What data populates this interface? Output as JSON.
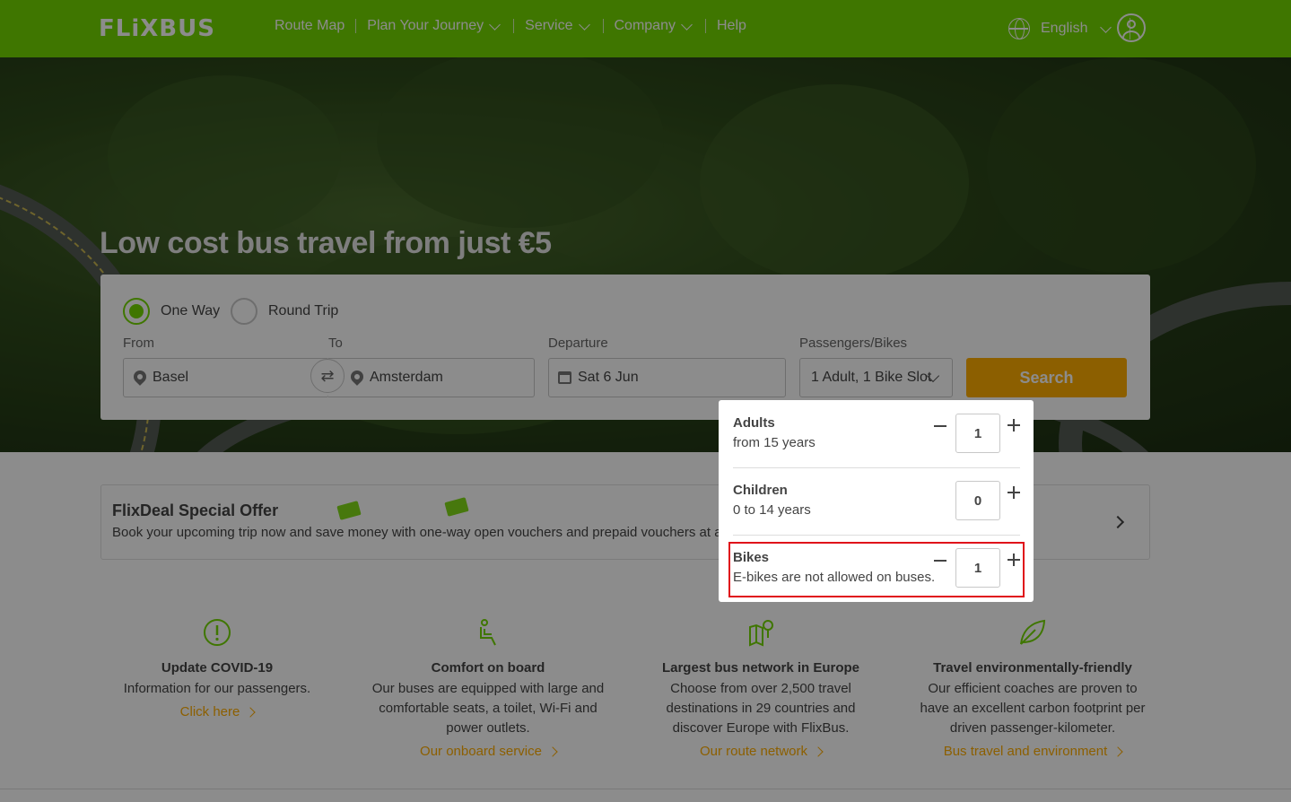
{
  "header": {
    "logo": "FLiXBUS",
    "nav": [
      "Route Map",
      "Plan Your Journey",
      "Service",
      "Company",
      "Help"
    ],
    "language": "English"
  },
  "hero": {
    "title": "Low cost bus travel from just €5"
  },
  "search": {
    "trip_types": [
      "One Way",
      "Round Trip"
    ],
    "selected_trip_type": "One Way",
    "from_label": "From",
    "to_label": "To",
    "departure_label": "Departure",
    "passengers_label": "Passengers/Bikes",
    "from_value": "Basel",
    "to_value": "Amsterdam",
    "departure_value": "Sat 6 Jun",
    "passengers_value": "1 Adult, 1 Bike Slot",
    "search_button": "Search"
  },
  "passengers_dropdown": {
    "rows": [
      {
        "title": "Adults",
        "subtitle": "from 15 years",
        "count": "1"
      },
      {
        "title": "Children",
        "subtitle": "0 to 14 years",
        "count": "0"
      },
      {
        "title": "Bikes",
        "subtitle": "E-bikes are not allowed on buses.",
        "count": "1"
      }
    ]
  },
  "offer": {
    "title": "FlixDeal Special Offer",
    "text": "Book your upcoming trip now and save money with one-way open vouchers and prepaid vouchers at a discount"
  },
  "features": [
    {
      "icon": "info-alert-icon",
      "title": "Update COVID-19",
      "text": "Information for our passengers.",
      "link": "Click here"
    },
    {
      "icon": "seat-icon",
      "title": "Comfort on board",
      "text": "Our buses are equipped with large and comfortable seats, a toilet, Wi-Fi and power outlets.",
      "link": "Our onboard service"
    },
    {
      "icon": "map-pin-icon",
      "title": "Largest bus network in Europe",
      "text": "Choose from over 2,500 travel destinations in 29 countries and discover Europe with FlixBus.",
      "link": "Our route network"
    },
    {
      "icon": "leaf-icon",
      "title": "Travel environmentally-friendly",
      "text": "Our efficient coaches are proven to have an excellent carbon footprint per driven passenger-kilometer.",
      "link": "Bus travel and environment"
    }
  ],
  "colors": {
    "brand_green": "#73d700",
    "accent_orange": "#ffad00",
    "highlight_red": "#e0101a"
  }
}
